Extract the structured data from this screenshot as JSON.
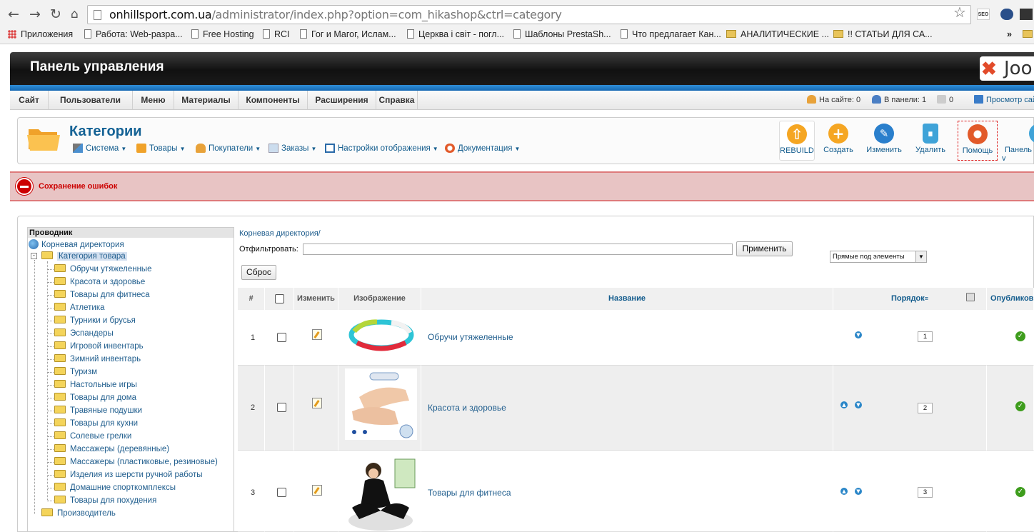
{
  "browser": {
    "url_host": "onhillsport.com.ua",
    "url_path": "/administrator/index.php?option=com_hikashop&ctrl=category",
    "seo_badge": "SEO",
    "bookmarks": [
      "Приложения",
      "Работа: Web-разра...",
      "Free Hosting",
      "RCI",
      "Гог и Магог, Ислам...",
      "Церква і світ - погл...",
      "Шаблоны PrestaSh...",
      "Что предлагает Кан...",
      "АНАЛИТИЧЕСКИЕ ...",
      "!!  СТАТЬИ ДЛЯ СА..."
    ],
    "more": "»"
  },
  "header": {
    "title": "Панель управления",
    "logo_text": "Joo"
  },
  "menu": {
    "items": [
      "Сайт",
      "Пользователи",
      "Меню",
      "Материалы",
      "Компоненты",
      "Расширения",
      "Справка"
    ],
    "on_site": "На сайте: 0",
    "in_panel": "В панели: 1",
    "messages": "0",
    "view_site": "Просмотр сайта"
  },
  "toolbar": {
    "page_title": "Категории",
    "submenu": [
      "Система",
      "Товары",
      "Покупатели",
      "Заказы",
      "Настройки отображения",
      "Документация"
    ],
    "buttons": [
      "REBUILD",
      "Создать",
      "Изменить",
      "Удалить",
      "Помощь",
      "Панель у"
    ]
  },
  "error": {
    "message": "Сохранение ошибок"
  },
  "explorer": {
    "title": "Проводник",
    "root": "Корневая директория",
    "category": "Категория товара",
    "children": [
      "Обручи утяжеленные",
      "Красота и здоровье",
      "Товары для фитнеса",
      "Атлетика",
      "Турники и брусья",
      "Эспандеры",
      "Игровой инвентарь",
      "Зимний инвентарь",
      "Туризм",
      "Настольные игры",
      "Товары для дома",
      "Травяные подушки",
      "Товары для кухни",
      "Солевые грелки",
      "Массажеры (деревянные)",
      "Массажеры (пластиковые, резиновые)",
      "Изделия из шерсти ручной работы",
      "Домашние спорткомплексы",
      "Товары для похудения"
    ],
    "manufacturer": "Производитель"
  },
  "list": {
    "breadcrumb": "Корневая директория/",
    "filter_label": "Отфильтровать:",
    "filter_value": "",
    "apply": "Применить",
    "reset": "Сброс",
    "scope_selected": "Прямые под элементы",
    "columns": {
      "num": "#",
      "edit": "Изменить",
      "image": "Изображение",
      "name": "Название",
      "order": "Порядок",
      "published": "Опубликов"
    },
    "rows": [
      {
        "num": "1",
        "name": "Обручи утяжеленные",
        "order": "1"
      },
      {
        "num": "2",
        "name": "Красота и здоровье",
        "order": "2"
      },
      {
        "num": "3",
        "name": "Товары для фитнеса",
        "order": "3"
      }
    ]
  },
  "colors": {
    "accent_blue": "#135c8d",
    "error_red": "#cc0000",
    "published_green": "#3e9d1d"
  }
}
